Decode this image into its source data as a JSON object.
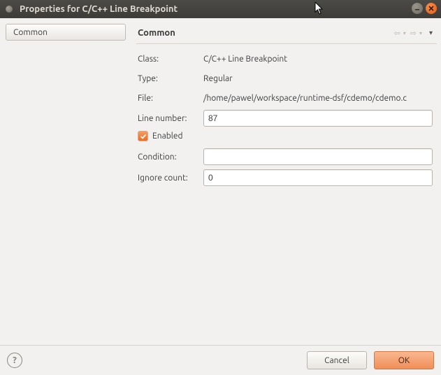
{
  "window": {
    "title": "Properties for C/C++ Line Breakpoint"
  },
  "sidebar": {
    "items": [
      {
        "label": "Common"
      }
    ]
  },
  "content": {
    "heading": "Common",
    "fields": {
      "class_label": "Class:",
      "class_value": "C/C++ Line Breakpoint",
      "type_label": "Type:",
      "type_value": "Regular",
      "file_label": "File:",
      "file_value": "/home/pawel/workspace/runtime-dsf/cdemo/cdemo.c",
      "line_label": "Line number:",
      "line_value": "87",
      "enabled_label": "Enabled",
      "enabled_checked": true,
      "condition_label": "Condition:",
      "condition_value": "",
      "ignore_label": "Ignore count:",
      "ignore_value": "0"
    }
  },
  "footer": {
    "cancel": "Cancel",
    "ok": "OK"
  }
}
